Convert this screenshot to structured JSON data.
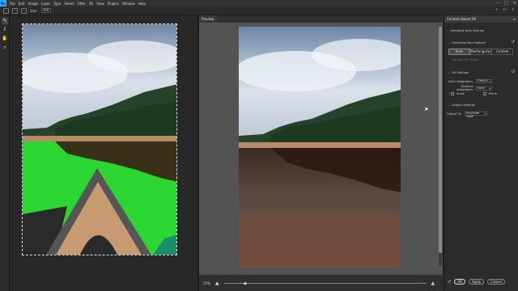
{
  "menubar": {
    "logo": "Ps",
    "items": [
      "File",
      "Edit",
      "Image",
      "Layer",
      "Type",
      "Select",
      "Filter",
      "3D",
      "View",
      "Plugins",
      "Window",
      "Help"
    ]
  },
  "optionsbar": {
    "size_label": "Size:",
    "size_value": "100"
  },
  "window_controls": [
    "—",
    "□",
    "✕"
  ],
  "preview": {
    "tab_label": "Preview",
    "zoom": "25%"
  },
  "panel": {
    "title": "Content-Aware Fill",
    "sampling_overlay": "Sampling Area Overlay",
    "sampling_options": "Sampling Area Options",
    "seg_options": [
      "Auto",
      "Rectangular",
      "Custom"
    ],
    "seg_selected": "Auto",
    "sample_all_layers": "Sample All Layers",
    "fill_settings": "Fill Settings",
    "color_adaptation_label": "Color Adaptation:",
    "color_adaptation_value": "Default",
    "rotation_adaptation_label": "Rotation Adaptation:",
    "rotation_adaptation_value": "None",
    "scale_label": "Scale",
    "mirror_label": "Mirror",
    "output_settings": "Output Settings",
    "output_to_label": "Output To:",
    "output_to_value": "Duplicate Layer",
    "reset_glyph": "↺",
    "buttons": {
      "reset_icon": "↺",
      "ok": "OK",
      "apply": "Apply",
      "cancel": "Cancel"
    }
  },
  "colors": {
    "accent": "#31a8ff",
    "overlay_green": "#2bd633"
  }
}
